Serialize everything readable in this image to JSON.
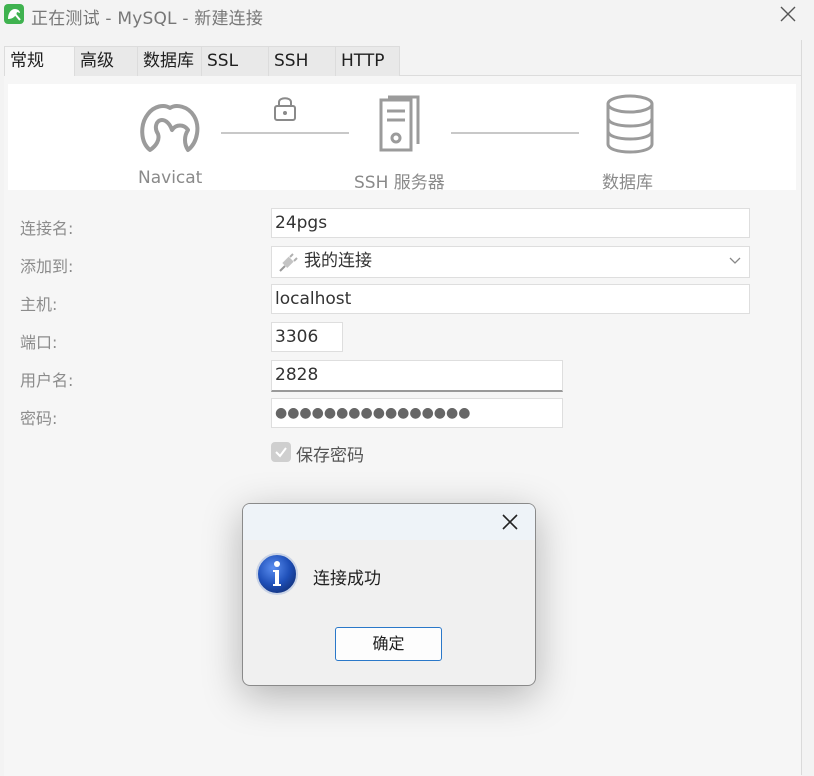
{
  "window": {
    "title": "正在测试 - MySQL - 新建连接"
  },
  "tabs": [
    {
      "label": "常规",
      "active": true
    },
    {
      "label": "高级"
    },
    {
      "label": "数据库"
    },
    {
      "label": "SSL"
    },
    {
      "label": "SSH"
    },
    {
      "label": "HTTP"
    }
  ],
  "diagram": {
    "client": "Navicat",
    "server": "SSH 服务器",
    "database": "数据库"
  },
  "form": {
    "connection_name": {
      "label": "连接名:",
      "value": "24pgs"
    },
    "add_to": {
      "label": "添加到:",
      "value": "我的连接"
    },
    "host": {
      "label": "主机:",
      "value": "localhost"
    },
    "port": {
      "label": "端口:",
      "value": "3306"
    },
    "username": {
      "label": "用户名:",
      "value": "2828"
    },
    "password": {
      "label": "密码:",
      "value": "●●●●●●●●●●●●●●●●"
    },
    "save_password": {
      "label": "保存密码",
      "checked": true
    }
  },
  "dialog": {
    "message": "连接成功",
    "ok_label": "确定",
    "icon": "info-icon"
  },
  "colors": {
    "accent": "#2a78c9",
    "app_icon": "#3fb24f",
    "info_blue": "#1e4fb8"
  }
}
